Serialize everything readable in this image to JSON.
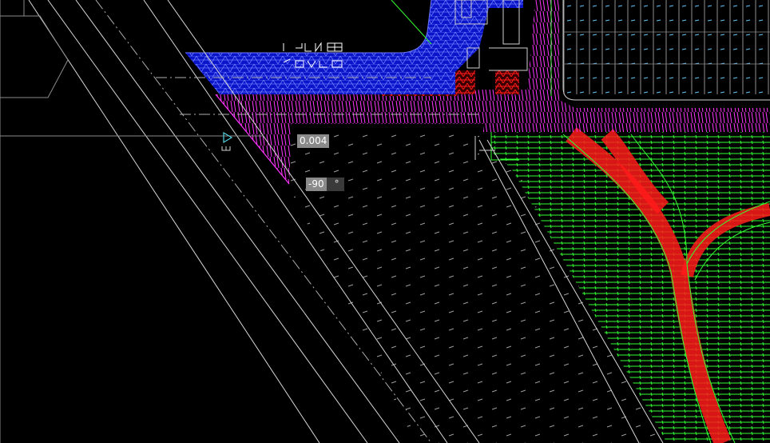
{
  "viewport": {
    "background": "#000000"
  },
  "dynamic_input": {
    "length_value": "0.004",
    "angle_value": "-90",
    "angle_unit": "°"
  },
  "layer_colors": {
    "blue_hatch": "#1a1aff",
    "magenta_hatch": "#ff33ff",
    "red_hatch": "#ff1a1a",
    "green_hatch": "#33ff33",
    "cyan_marks": "#66c8ff",
    "white_lines": "#d8d8d8",
    "gray_lines": "#7a7a7a"
  },
  "icons": {
    "ucs_marker": "triangle-cursor-icon"
  }
}
